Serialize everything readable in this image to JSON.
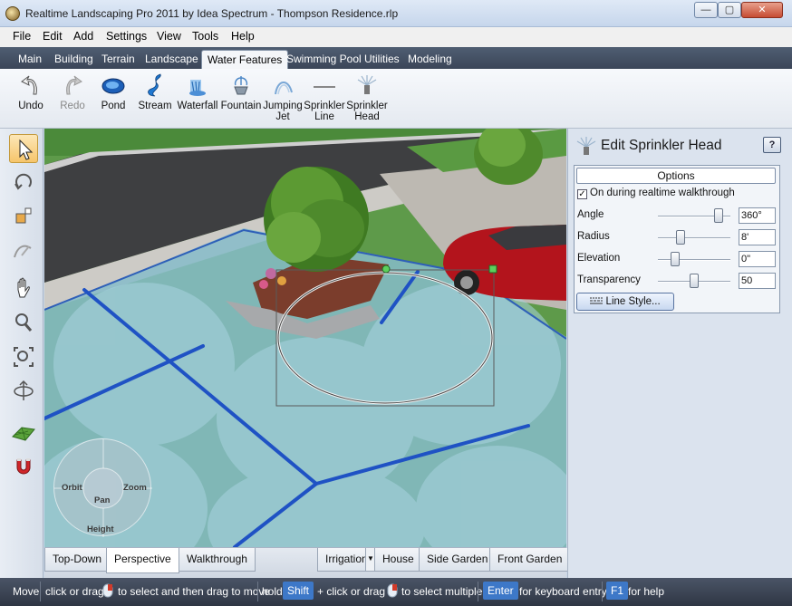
{
  "window": {
    "title": "Realtime Landscaping Pro 2011 by Idea Spectrum - Thompson Residence.rlp",
    "controls": {
      "minimize": "—",
      "maximize": "▢",
      "close": "✕"
    }
  },
  "menu": {
    "items": [
      "File",
      "Edit",
      "Add",
      "Settings",
      "View",
      "Tools",
      "Help"
    ]
  },
  "tabs": {
    "items": [
      "Main",
      "Building",
      "Terrain",
      "Landscape",
      "Water Features",
      "Swimming Pool",
      "Utilities",
      "Modeling"
    ],
    "active": "Water Features"
  },
  "toolbar": {
    "undo": "Undo",
    "redo": "Redo",
    "pond": "Pond",
    "stream": "Stream",
    "waterfall": "Waterfall",
    "fountain": "Fountain",
    "jumping_jet_1": "Jumping",
    "jumping_jet_2": "Jet",
    "sprinkler_line_1": "Sprinkler",
    "sprinkler_line_2": "Line",
    "sprinkler_head_1": "Sprinkler",
    "sprinkler_head_2": "Head"
  },
  "navwheel": {
    "orbit": "Orbit",
    "zoom": "Zoom",
    "pan": "Pan",
    "height": "Height"
  },
  "viewtabs": {
    "top_down": "Top-Down",
    "perspective": "Perspective",
    "walkthrough": "Walkthrough",
    "irrigation": "Irrigation",
    "house": "House",
    "side_garden": "Side Garden",
    "front_garden": "Front Garden",
    "active": "Perspective"
  },
  "panel": {
    "title": "Edit Sprinkler Head",
    "help": "?",
    "options_header": "Options",
    "checkbox_label": "On during realtime walkthrough",
    "checkbox_checked": true,
    "check_mark": "✓",
    "angle_label": "Angle",
    "angle_value": "360°",
    "angle_fraction": 0.88,
    "radius_label": "Radius",
    "radius_value": "8'",
    "radius_fraction": 0.28,
    "elevation_label": "Elevation",
    "elevation_value": "0\"",
    "elevation_fraction": 0.2,
    "transparency_label": "Transparency",
    "transparency_value": "50",
    "transparency_fraction": 0.5,
    "line_style_button": "Line Style..."
  },
  "status": {
    "move": "Move",
    "click_or_drag_1": "click or drag",
    "select_then_move": "to select and then drag to move",
    "hold": "hold",
    "shift_key": "Shift",
    "plus_click_or_drag": "+ click or drag",
    "select_multiple": "to select multiple",
    "enter_key": "Enter",
    "keyboard_entry": "for keyboard entry",
    "f1_key": "F1",
    "for_help": "for help"
  }
}
